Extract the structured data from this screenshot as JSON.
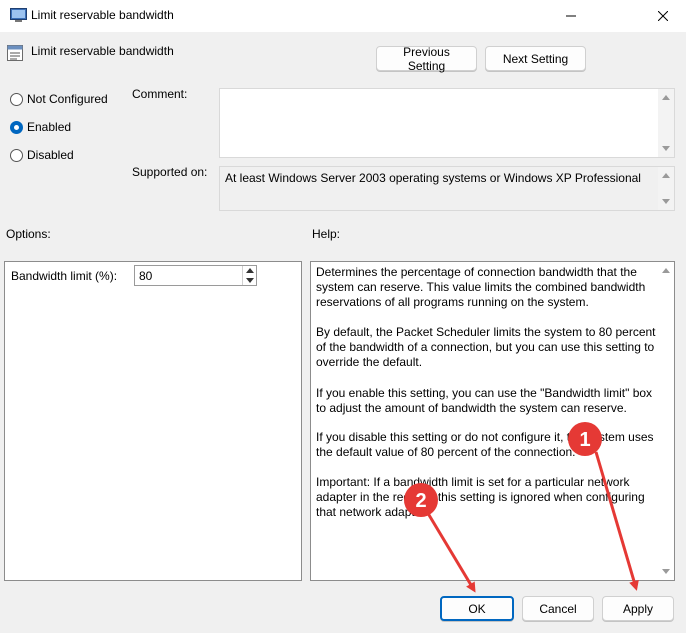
{
  "window": {
    "title": "Limit reservable bandwidth",
    "minimize_icon": "minimize-icon",
    "close_icon": "close-icon"
  },
  "header": {
    "title": "Limit reservable bandwidth",
    "icon": "policy-setting-icon",
    "prev_label": "Previous Setting",
    "next_label": "Next Setting"
  },
  "state": {
    "options": [
      {
        "label": "Not Configured",
        "checked": false
      },
      {
        "label": "Enabled",
        "checked": true
      },
      {
        "label": "Disabled",
        "checked": false
      }
    ]
  },
  "comment": {
    "label": "Comment:",
    "value": ""
  },
  "supported": {
    "label": "Supported on:",
    "value": "At least Windows Server 2003 operating systems or Windows XP Professional"
  },
  "options_section": {
    "label": "Options:",
    "bandwidth_label": "Bandwidth limit (%):",
    "bandwidth_value": "80"
  },
  "help_section": {
    "label": "Help:",
    "paragraphs": [
      "Determines the percentage of connection bandwidth that the system can reserve. This value limits the combined bandwidth reservations of all programs running on the system.",
      "By default, the Packet Scheduler limits the system to 80 percent of the bandwidth of a connection, but you can use this setting to override the default.",
      "If you enable this setting, you can use the \"Bandwidth limit\" box to adjust the amount of bandwidth the system can reserve.",
      "If you disable this setting or do not configure it, the system uses the default value of 80 percent of the connection.",
      "Important: If a bandwidth limit is set for a particular network adapter in the registry, this setting is ignored when configuring that network adapter."
    ]
  },
  "footer": {
    "ok_label": "OK",
    "cancel_label": "Cancel",
    "apply_label": "Apply"
  },
  "annotations": {
    "marker1": "1",
    "marker2": "2",
    "color": "#e53935"
  }
}
